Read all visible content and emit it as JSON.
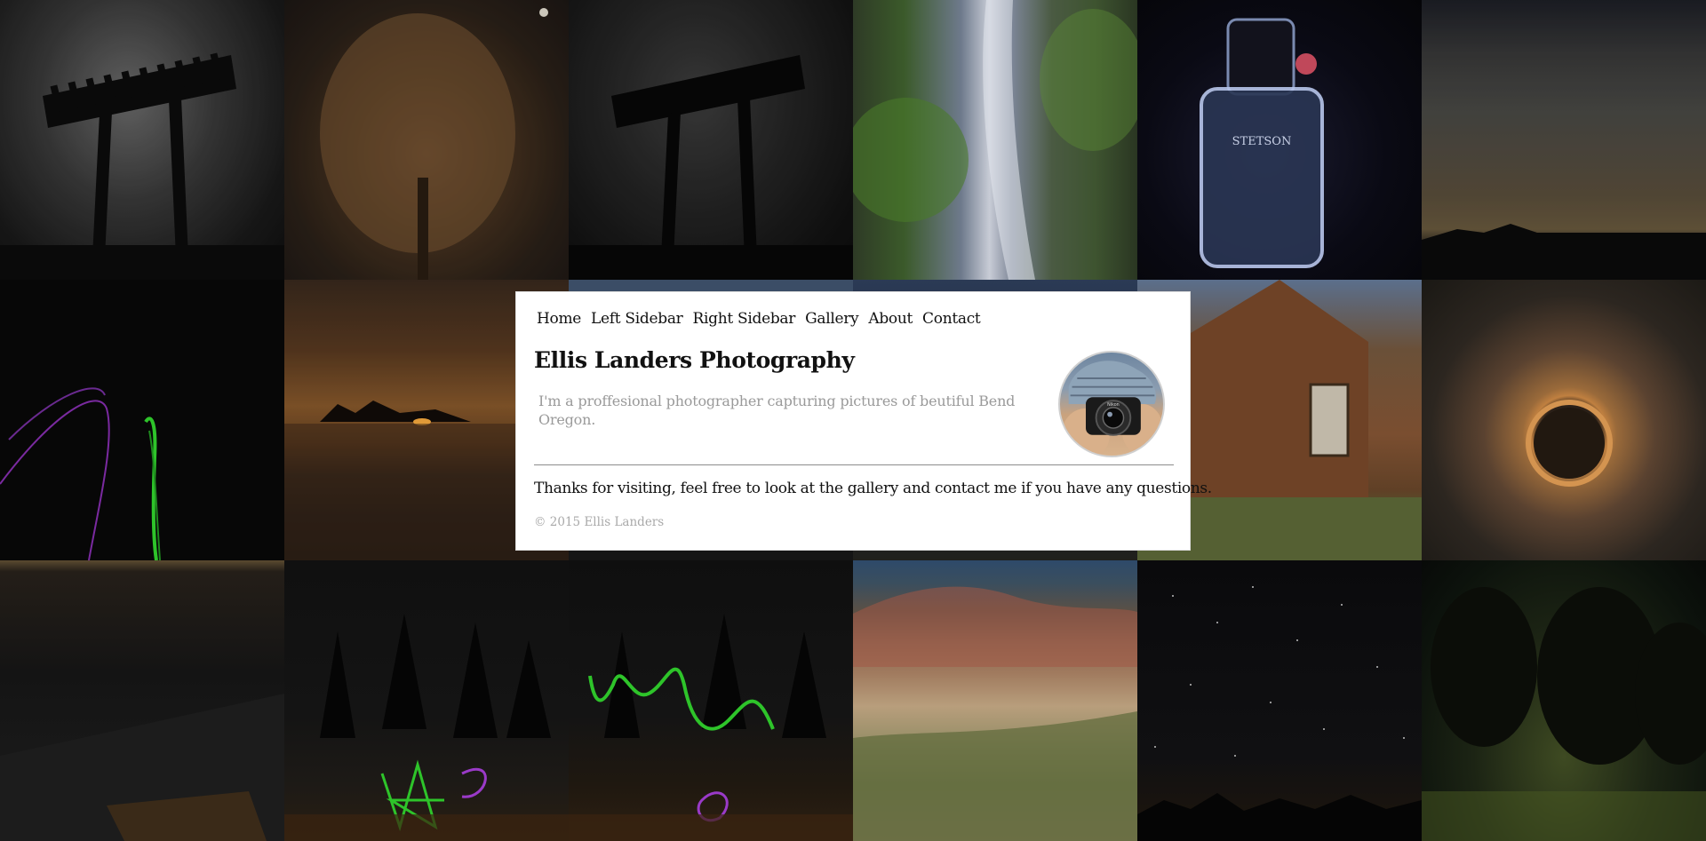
{
  "nav": {
    "items": [
      {
        "label": "Home",
        "name": "nav-home"
      },
      {
        "label": "Left Sidebar",
        "name": "nav-left-sidebar"
      },
      {
        "label": "Right Sidebar",
        "name": "nav-right-sidebar"
      },
      {
        "label": "Gallery",
        "name": "nav-gallery"
      },
      {
        "label": "About",
        "name": "nav-about"
      },
      {
        "label": "Contact",
        "name": "nav-contact"
      }
    ]
  },
  "header": {
    "title": "Ellis Landers Photography",
    "tagline": "I'm a proffesional photographer capturing pictures of beutiful Bend Oregon."
  },
  "avatar": {
    "alt": "photographer-with-camera-avatar",
    "camera_brand": "Nikon"
  },
  "main": {
    "welcome": "Thanks for visiting, feel free to look at the gallery and contact me if you have any questions."
  },
  "footer": {
    "copyright": "© 2015 Ellis Landers"
  },
  "background_gallery": {
    "tiles": [
      "pergola-night",
      "tree-night",
      "pergola-night-dark",
      "waterfall",
      "stetson-bottle",
      "dusk-sky",
      "light-painting",
      "ocean-sunset",
      "night-tile",
      "night-tile",
      "old-barn",
      "steel-wool-spin",
      "roof-night",
      "light-painting-trees",
      "light-painting-wave",
      "painted-hills",
      "starry-sky",
      "lit-forest"
    ],
    "bottle_label": "STETSON"
  },
  "colors": {
    "card_background": "#ffffff",
    "text_primary": "#111111",
    "text_muted": "#9a9a9a",
    "divider": "#8c8c8c",
    "page_background": "#000000"
  }
}
